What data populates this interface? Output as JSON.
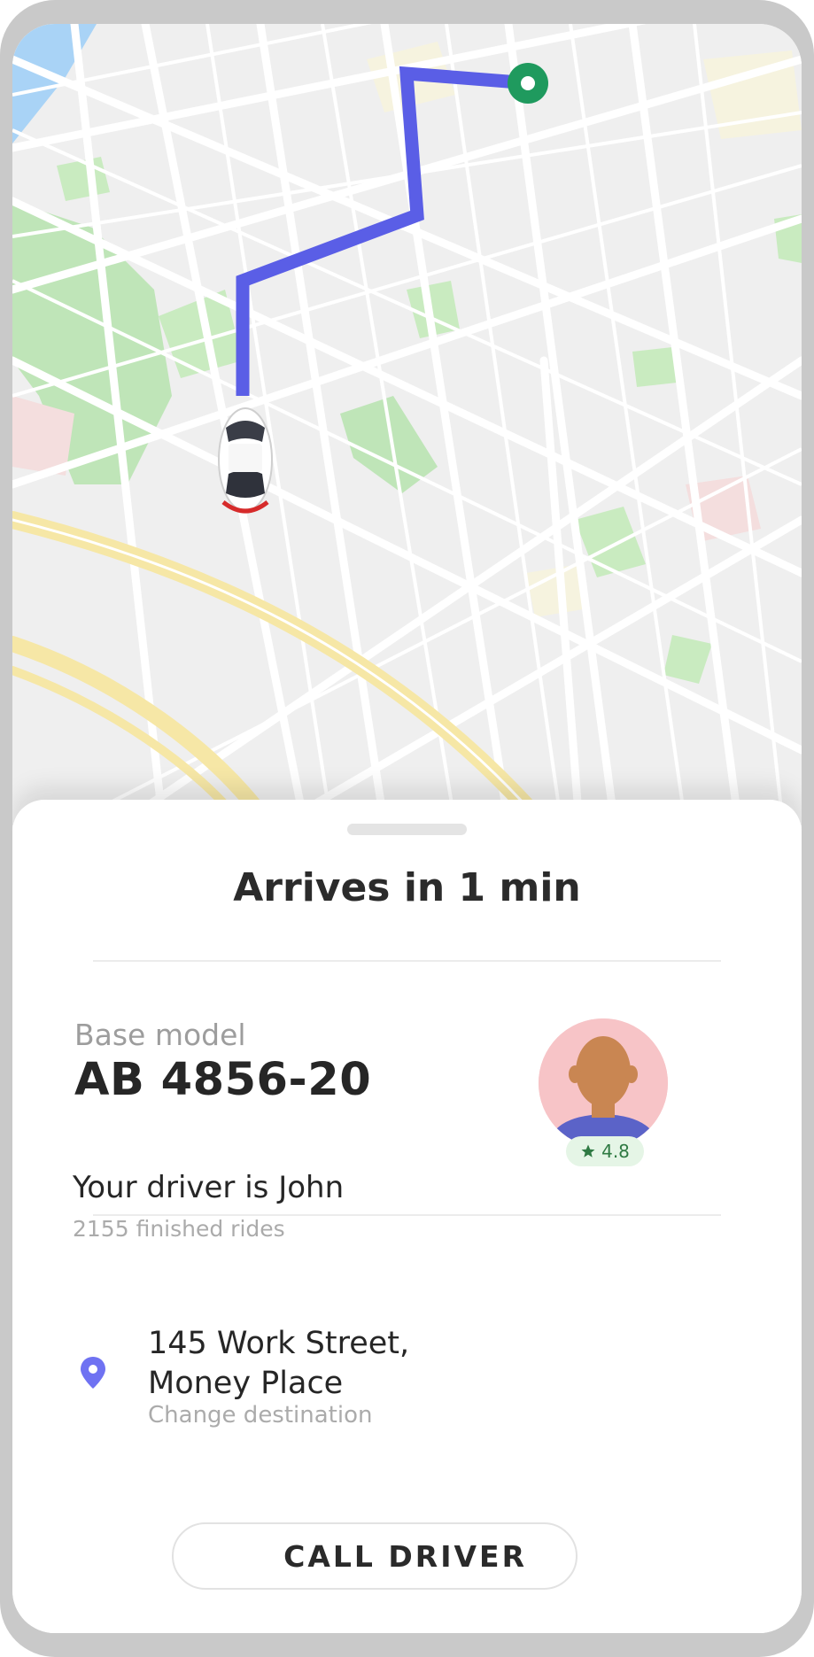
{
  "eta": "Arrives in 1 min",
  "car": {
    "model": "Base model",
    "plate": "AB 4856-20"
  },
  "driver": {
    "intro": "Your driver is John",
    "rides": "2155 finished rides",
    "rating": "4.8"
  },
  "destination": {
    "line1": "145 Work Street,",
    "line2": "Money Place",
    "change": "Change destination"
  },
  "call_button": "CALL DRIVER",
  "colors": {
    "route": "#5a5ee6",
    "destination_marker": "#1f9a5e",
    "pin": "#6f72f2",
    "rating_star": "#2f7a43"
  },
  "icons": {
    "destination_marker": "destination-marker-icon",
    "car": "car-icon",
    "pin": "location-pin-icon",
    "star": "star-icon"
  }
}
